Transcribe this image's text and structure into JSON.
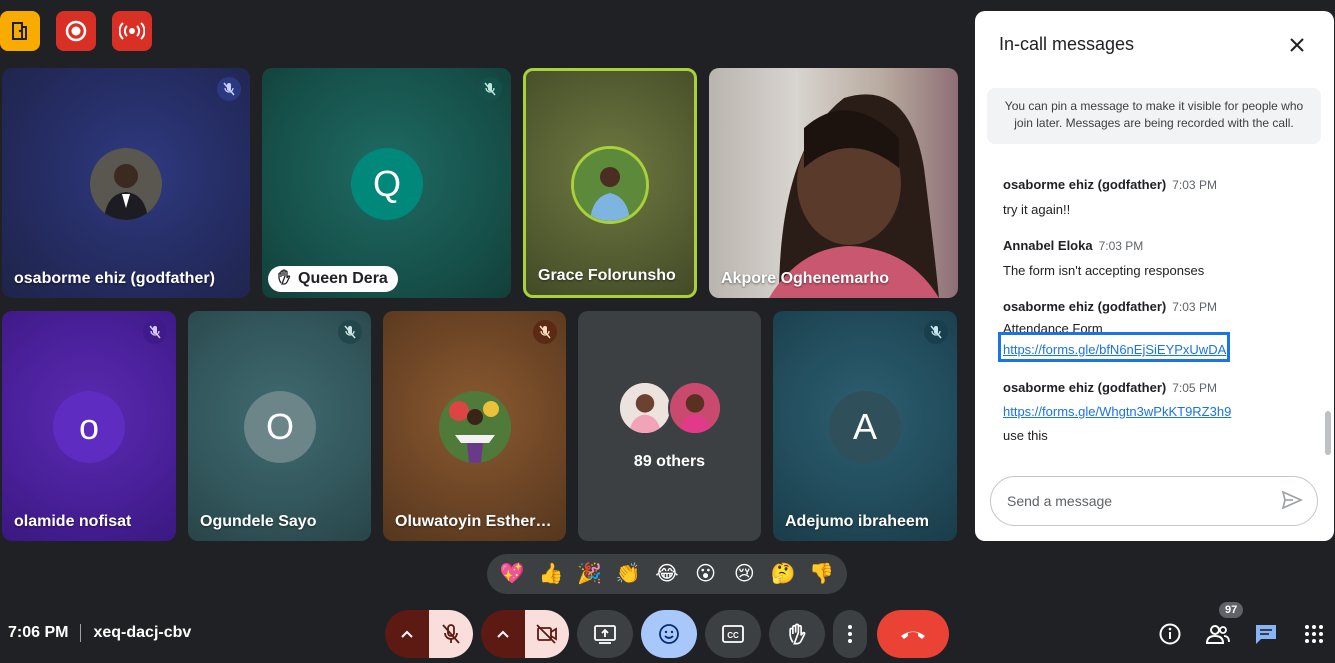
{
  "top_icons": [
    "door-icon",
    "record-icon",
    "broadcast-icon"
  ],
  "tiles": [
    {
      "name": "osaborme ehiz (godfather)"
    },
    {
      "name": "Queen Dera",
      "initial": "Q"
    },
    {
      "name": "Grace Folorunsho"
    },
    {
      "name": "Akpore Oghenemarho"
    },
    {
      "name": "olamide nofisat",
      "initial": "o"
    },
    {
      "name": "Ogundele Sayo",
      "initial": "O"
    },
    {
      "name": "Oluwatoyin Esther…"
    },
    {
      "name": "89 others"
    },
    {
      "name": "Adejumo ibraheem",
      "initial": "A"
    }
  ],
  "reactions": [
    "💖",
    "👍",
    "🎉",
    "👏",
    "😂",
    "😮",
    "😢",
    "🤔",
    "👎"
  ],
  "bottom": {
    "time": "7:06 PM",
    "meeting_code": "xeq-dacj-cbv",
    "participants_count": "97"
  },
  "panel": {
    "title": "In-call messages",
    "pin_note": "You can pin a message to make it visible for people who join later. Messages are being recorded with the call.",
    "messages": [
      {
        "sender": "osaborme ehiz (godfather)",
        "time": "7:03 PM",
        "text": "try it again!!"
      },
      {
        "sender": "Annabel Eloka",
        "time": "7:03 PM",
        "text": "The form isn't accepting responses"
      },
      {
        "sender": "osaborme ehiz (godfather)",
        "time": "7:03 PM",
        "text": "Attendance Form",
        "link": "https://forms.gle/bfN6nEjSiEYPxUwDA"
      },
      {
        "sender": "osaborme ehiz (godfather)",
        "time": "7:05 PM",
        "link": "https://forms.gle/Whgtn3wPkKT9RZ3h9",
        "text": "use this"
      }
    ],
    "composer_placeholder": "Send a message"
  },
  "colors": {
    "background": "#202124",
    "end_call": "#ea4335",
    "accent": "#1a73e8",
    "muted_red": "#5c1a12"
  }
}
